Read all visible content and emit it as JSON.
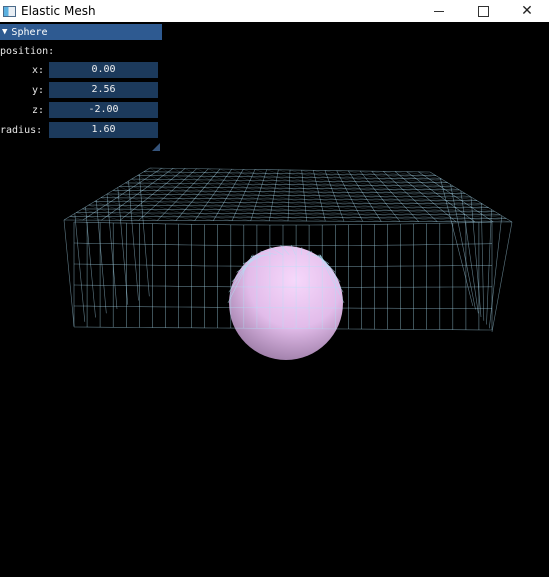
{
  "window": {
    "title": "Elastic Mesh",
    "controls": {
      "minimize": "minimize",
      "maximize": "maximize",
      "close": "✕"
    }
  },
  "panel": {
    "header": "Sphere",
    "section_label": "position:",
    "fields": {
      "x": {
        "label": "x:",
        "value": "0.00"
      },
      "y": {
        "label": "y:",
        "value": "2.56"
      },
      "z": {
        "label": "z:",
        "value": "-2.00"
      },
      "radius": {
        "label": "radius:",
        "value": "1.60"
      }
    }
  },
  "colors": {
    "mesh": "#aee2f7",
    "sphere": "#e7c3ee",
    "panel_header": "#2e5a91",
    "field_bg": "#1c3a5c"
  }
}
